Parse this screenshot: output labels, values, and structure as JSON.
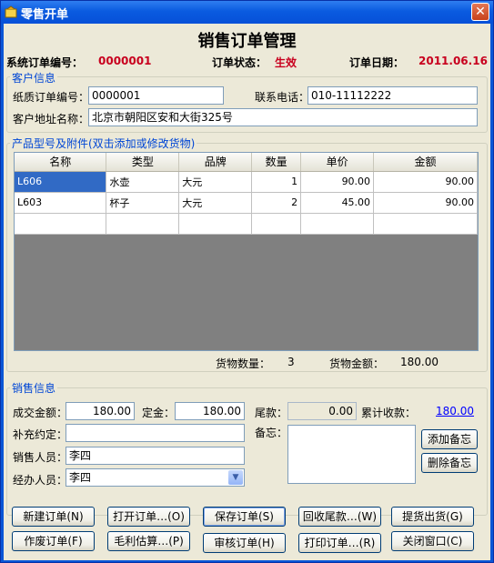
{
  "window": {
    "title": "零售开单",
    "close_label": "✕"
  },
  "heading": "销售订单管理",
  "summary": {
    "order_no_label": "系统订单编号：",
    "order_no": "0000001",
    "status_label": "订单状态：",
    "status": "生效",
    "date_label": "订单日期：",
    "date": "2011.06.16"
  },
  "customer": {
    "group_title": "客户信息",
    "paper_no_label": "纸质订单编号：",
    "paper_no": "0000001",
    "phone_label": "联系电话：",
    "phone": "010-11112222",
    "address_label": "客户地址名称：",
    "address": "北京市朝阳区安和大街325号"
  },
  "products": {
    "group_title": "产品型号及附件(双击添加或修改货物)",
    "columns": [
      "名称",
      "类型",
      "品牌",
      "数量",
      "单价",
      "金额"
    ],
    "rows": [
      [
        "L606",
        "水壶",
        "大元",
        "1",
        "90.00",
        "90.00"
      ],
      [
        "L603",
        "杯子",
        "大元",
        "2",
        "45.00",
        "90.00"
      ]
    ],
    "count_label": "货物数量：",
    "count": "3",
    "amount_label": "货物金额：",
    "amount": "180.00"
  },
  "sales": {
    "group_title": "销售信息",
    "deal_label": "成交金额：",
    "deal": "180.00",
    "deposit_label": "定金：",
    "deposit": "180.00",
    "balance_label": "尾款：",
    "balance": "0.00",
    "collected_label": "累计收款：",
    "collected": "180.00",
    "extra_label": "补充约定：",
    "extra": "",
    "memo_label": "备忘：",
    "memo": "",
    "salesperson_label": "销售人员：",
    "salesperson": "李四",
    "handler_label": "经办人员：",
    "handler": "李四",
    "add_memo": "添加备忘",
    "delete_memo": "删除备忘"
  },
  "buttons": {
    "new_order": "新建订单(N)",
    "open_order": "打开订单…(O)",
    "save_order": "保存订单(S)",
    "collect_balance": "回收尾款…(W)",
    "deliver": "提货出货(G)",
    "void_order": "作废订单(F)",
    "profit": "毛利估算…(P)",
    "audit": "审核订单(H)",
    "print": "打印订单…(R)",
    "close": "关闭窗口(C)"
  }
}
